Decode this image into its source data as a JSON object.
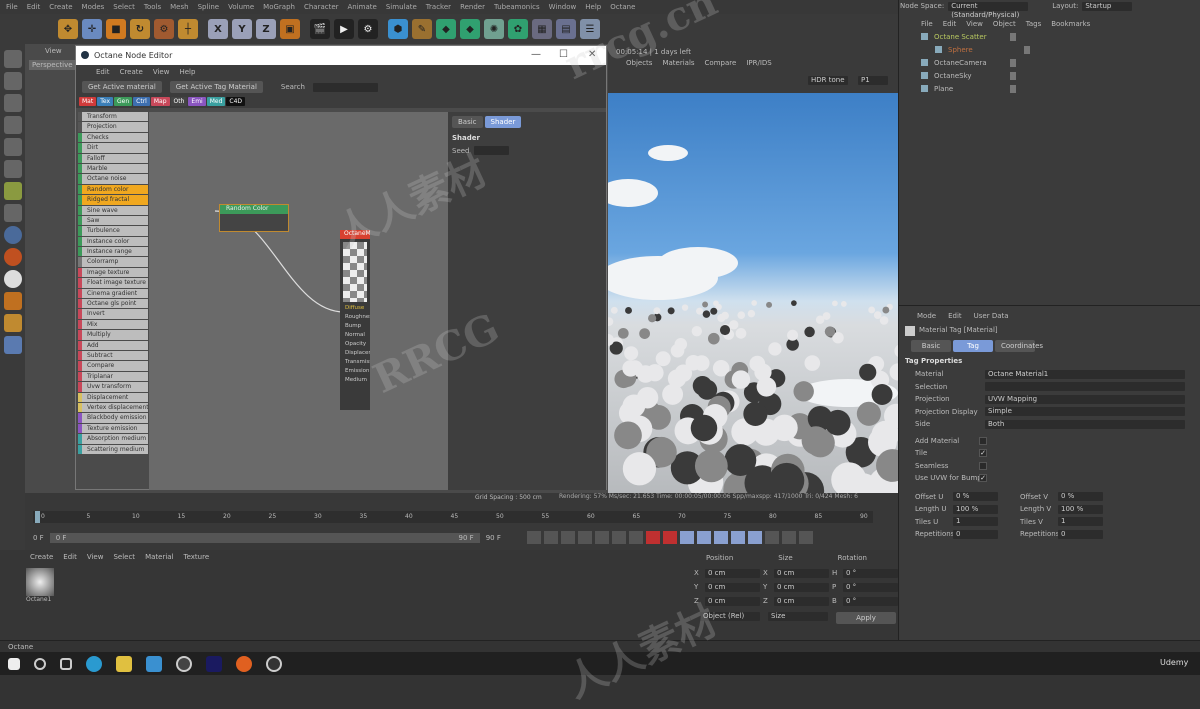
{
  "menubar": {
    "items": [
      "File",
      "Edit",
      "Create",
      "Modes",
      "Select",
      "Tools",
      "Mesh",
      "Spline",
      "Volume",
      "MoGraph",
      "Character",
      "Animate",
      "Simulate",
      "Tracker",
      "Render",
      "Tubeamonics",
      "Window",
      "Help",
      "Octane"
    ],
    "node_space_label": "Node Space:",
    "node_space_value": "Current (Standard/Physical)",
    "layout_label": "Layout:",
    "layout_value": "Startup"
  },
  "toolbar": {
    "axis": [
      "X",
      "Y",
      "Z"
    ]
  },
  "viewport": {
    "menu": "View",
    "camera": "Perspective"
  },
  "node_editor": {
    "title": "Octane Node Editor",
    "menu": [
      "Edit",
      "Create",
      "View",
      "Help"
    ],
    "buttons": [
      "Get Active material",
      "Get Active Tag Material"
    ],
    "search_label": "Search",
    "tabs": [
      {
        "label": "Mat",
        "color": "#d13a3a"
      },
      {
        "label": "Tex",
        "color": "#3b7fb8"
      },
      {
        "label": "Gen",
        "color": "#3c9a5a"
      },
      {
        "label": "Ctrl",
        "color": "#3d6fb0"
      },
      {
        "label": "Map",
        "color": "#c8485a"
      },
      {
        "label": "Oth",
        "color": "#444444"
      },
      {
        "label": "Emi",
        "color": "#8a55c0"
      },
      {
        "label": "Med",
        "color": "#3aa0a0"
      },
      {
        "label": "C4D",
        "color": "#111111"
      }
    ],
    "nodes": [
      {
        "label": "Transform",
        "color": "#555"
      },
      {
        "label": "Projection",
        "color": "#555"
      },
      {
        "label": "Checks",
        "color": "#3c9a5a"
      },
      {
        "label": "Dirt",
        "color": "#3c9a5a"
      },
      {
        "label": "Falloff",
        "color": "#3c9a5a"
      },
      {
        "label": "Marble",
        "color": "#3c9a5a"
      },
      {
        "label": "Octane noise",
        "color": "#3c9a5a"
      },
      {
        "label": "Random color",
        "color": "#3c9a5a",
        "hl": true
      },
      {
        "label": "Ridged fractal",
        "color": "#3c9a5a",
        "hl": true
      },
      {
        "label": "Sine wave",
        "color": "#3c9a5a"
      },
      {
        "label": "Saw",
        "color": "#3c9a5a"
      },
      {
        "label": "Turbulence",
        "color": "#3c9a5a"
      },
      {
        "label": "Instance color",
        "color": "#3c9a5a"
      },
      {
        "label": "Instance range",
        "color": "#3c9a5a"
      },
      {
        "label": "Colorramp",
        "color": "#777"
      },
      {
        "label": "Image texture",
        "color": "#c8485a"
      },
      {
        "label": "Float image texture",
        "color": "#c8485a"
      },
      {
        "label": "Cinema gradient",
        "color": "#c8485a"
      },
      {
        "label": "Octane gls point",
        "color": "#c8485a"
      },
      {
        "label": "Invert",
        "color": "#c8485a"
      },
      {
        "label": "Mix",
        "color": "#c8485a"
      },
      {
        "label": "Multiply",
        "color": "#c8485a"
      },
      {
        "label": "Add",
        "color": "#c8485a"
      },
      {
        "label": "Subtract",
        "color": "#c8485a"
      },
      {
        "label": "Compare",
        "color": "#c8485a"
      },
      {
        "label": "Triplanar",
        "color": "#c8485a"
      },
      {
        "label": "Uvw transform",
        "color": "#c8485a"
      },
      {
        "label": "Displacement",
        "color": "#d8c060"
      },
      {
        "label": "Vertex displacement",
        "color": "#d8c060"
      },
      {
        "label": "Blackbody emission",
        "color": "#8a55c0"
      },
      {
        "label": "Texture emission",
        "color": "#8a55c0"
      },
      {
        "label": "Absorption medium",
        "color": "#3aa0a0"
      },
      {
        "label": "Scattering medium",
        "color": "#3aa0a0"
      }
    ],
    "random_color_node": "Random Color",
    "material_node": {
      "title": "OctaneMaterial",
      "pins": [
        "Diffuse",
        "Roughness",
        "Bump",
        "Normal",
        "Opacity",
        "Displacement",
        "Transmission",
        "Emission",
        "Medium"
      ]
    },
    "panel": {
      "tabs": [
        "Basic",
        "Shader"
      ],
      "section": "Shader",
      "seed_label": "Seed"
    }
  },
  "render": {
    "menu": [
      "Objects",
      "Materials",
      "Compare",
      "IPR/IDS"
    ],
    "time": "00:05:14 | 1 days left",
    "tone": "HDR tone",
    "pass": "P1",
    "stats": "Rendering: 57%   Ms/sec: 21.653   Time: 00:00:05/00:00:06   Spp/maxspp: 417/1000   Tri: 0/424   Mesh: 6",
    "grid": "Grid Spacing : 500 cm"
  },
  "object_manager": {
    "menu": [
      "File",
      "Edit",
      "View",
      "Object",
      "Tags",
      "Bookmarks"
    ],
    "objects": [
      {
        "name": "Octane Scatter",
        "color": "#b8c860"
      },
      {
        "name": "Sphere",
        "color": "#c07040"
      },
      {
        "name": "OctaneCamera",
        "color": "#bbb"
      },
      {
        "name": "OctaneSky",
        "color": "#bbb"
      },
      {
        "name": "Plane",
        "color": "#bbb"
      }
    ]
  },
  "attributes": {
    "menu": [
      "Mode",
      "Edit",
      "User Data"
    ],
    "object": "Material Tag [Material]",
    "tabs": [
      "Basic",
      "Tag",
      "Coordinates"
    ],
    "section": "Tag Properties",
    "props": [
      {
        "label": "Material",
        "value": "Octane Material1"
      },
      {
        "label": "Selection",
        "value": ""
      },
      {
        "label": "Projection",
        "value": "UVW Mapping"
      },
      {
        "label": "Projection Display",
        "value": "Simple"
      },
      {
        "label": "Side",
        "value": "Both"
      }
    ],
    "checks": [
      {
        "label": "Add Material",
        "checked": false
      },
      {
        "label": "Tile",
        "checked": true
      },
      {
        "label": "Seamless",
        "checked": false
      },
      {
        "label": "Use UVW for Bump",
        "checked": true
      }
    ],
    "pairs": [
      [
        "Offset U",
        "0 %",
        "Offset V",
        "0 %"
      ],
      [
        "Length U",
        "100 %",
        "Length V",
        "100 %"
      ],
      [
        "Tiles U",
        "1",
        "Tiles V",
        "1"
      ],
      [
        "Repetitions U",
        "0",
        "Repetitions V",
        "0"
      ]
    ]
  },
  "timeline": {
    "ticks": [
      "0",
      "5",
      "10",
      "15",
      "20",
      "25",
      "30",
      "35",
      "40",
      "45",
      "50",
      "55",
      "60",
      "65",
      "70",
      "75",
      "80",
      "85",
      "90"
    ],
    "current": "0 F",
    "start": "0 F",
    "end": "90 F",
    "end2": "90 F",
    "frame_field": "0 F"
  },
  "materials": {
    "menu": [
      "Create",
      "Edit",
      "View",
      "Select",
      "Material",
      "Texture"
    ],
    "items": [
      "Octane1"
    ]
  },
  "coordinates": {
    "headers": [
      "Position",
      "Size",
      "Rotation"
    ],
    "rows": [
      [
        "X",
        "0 cm",
        "X",
        "0 cm",
        "H",
        "0 °"
      ],
      [
        "Y",
        "0 cm",
        "Y",
        "0 cm",
        "P",
        "0 °"
      ],
      [
        "Z",
        "0 cm",
        "Z",
        "0 cm",
        "B",
        "0 °"
      ]
    ],
    "mode": "Object (Rel)",
    "size_mode": "Size",
    "apply": "Apply"
  },
  "status": "Octane",
  "watermarks": [
    "rrcg.cn",
    "RRCG",
    "人人素材",
    "人人素材",
    "Udemy"
  ]
}
